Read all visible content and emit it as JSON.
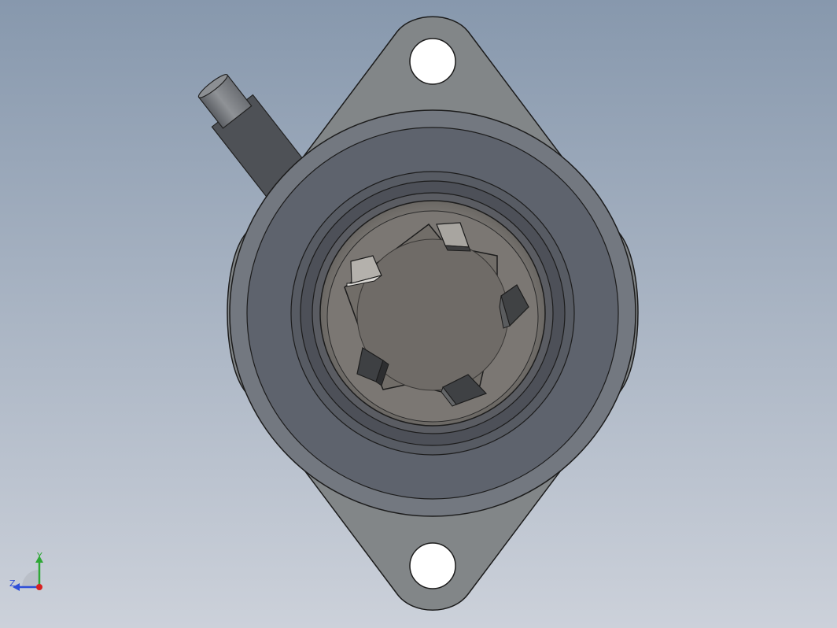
{
  "view": {
    "background_top": "#8a9bb0",
    "background_bottom": "#c9ced8",
    "model": "flange-bearing-housing",
    "bolt_holes": 2,
    "locking_lugs": 5
  },
  "triad": {
    "y_label": "Y",
    "z_label": "Z",
    "y_color": "#2fa836",
    "z_color": "#2f4fd8",
    "origin_color": "#d82020"
  }
}
